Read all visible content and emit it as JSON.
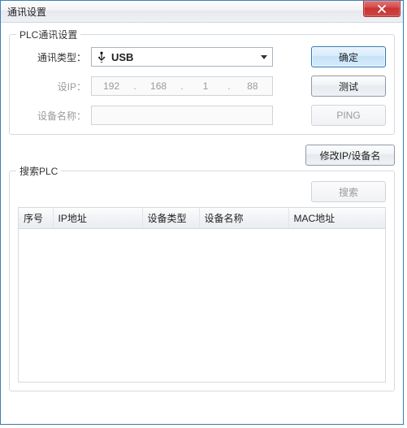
{
  "window": {
    "title": "通讯设置"
  },
  "group_comm": {
    "title": "PLC通讯设置",
    "type_label": "通讯类型：",
    "type_value": "USB",
    "ip_label": "设IP：",
    "ip": {
      "o1": "192",
      "o2": "168",
      "o3": "1",
      "o4": "88"
    },
    "name_label": "设备名称：",
    "name_value": ""
  },
  "buttons": {
    "ok": "确定",
    "test": "测试",
    "ping": "PING",
    "modify": "修改IP/设备名",
    "search": "搜索"
  },
  "group_search": {
    "title": "搜索PLC",
    "columns": {
      "seq": "序号",
      "ip": "IP地址",
      "type": "设备类型",
      "name": "设备名称",
      "mac": "MAC地址"
    }
  }
}
